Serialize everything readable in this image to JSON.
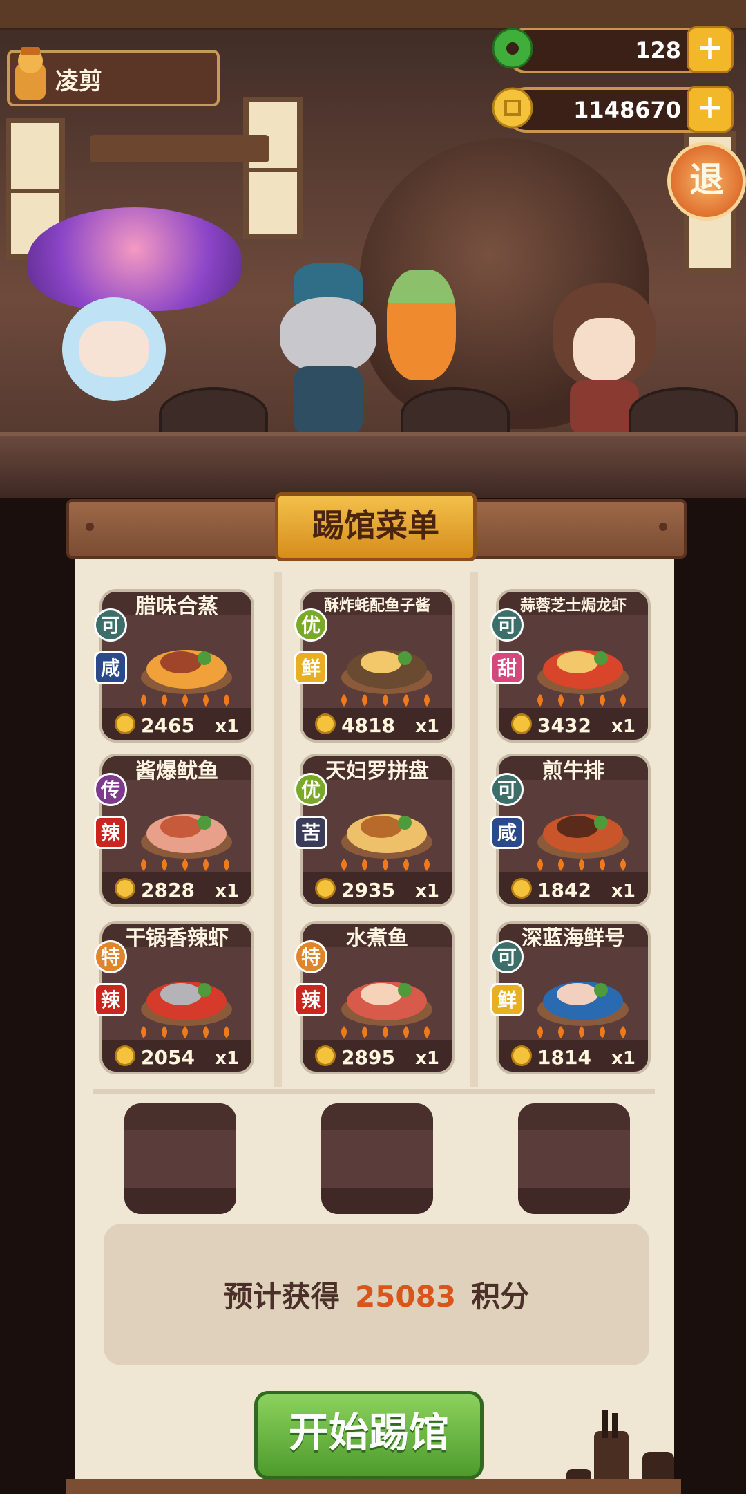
{
  "player": {
    "name": "凌剪"
  },
  "currencies": {
    "jade": {
      "value": "128",
      "icon": "jade-coin-icon",
      "plus": "+"
    },
    "gold": {
      "value": "1148670",
      "icon": "gold-coin-icon",
      "plus": "+"
    }
  },
  "exit_label": "退",
  "menu_title": "踢馆菜单",
  "dishes": [
    {
      "name": "腊味合蒸",
      "grade": "可",
      "flavor": "咸",
      "price": "2465",
      "qty": "x1"
    },
    {
      "name": "酥炸蚝配鱼子酱",
      "grade": "优",
      "flavor": "鲜",
      "price": "4818",
      "qty": "x1"
    },
    {
      "name": "蒜蓉芝士焗龙虾",
      "grade": "可",
      "flavor": "甜",
      "price": "3432",
      "qty": "x1"
    },
    {
      "name": "酱爆鱿鱼",
      "grade": "传",
      "flavor": "辣",
      "price": "2828",
      "qty": "x1"
    },
    {
      "name": "天妇罗拼盘",
      "grade": "优",
      "flavor": "苦",
      "price": "2935",
      "qty": "x1"
    },
    {
      "name": "煎牛排",
      "grade": "可",
      "flavor": "咸",
      "price": "1842",
      "qty": "x1"
    },
    {
      "name": "干锅香辣虾",
      "grade": "特",
      "flavor": "辣",
      "price": "2054",
      "qty": "x1"
    },
    {
      "name": "水煮鱼",
      "grade": "特",
      "flavor": "辣",
      "price": "2895",
      "qty": "x1"
    },
    {
      "name": "深蓝海鲜号",
      "grade": "可",
      "flavor": "鲜",
      "price": "1814",
      "qty": "x1"
    }
  ],
  "estimate": {
    "prefix": "预计获得",
    "points": "25083",
    "suffix": "积分"
  },
  "start_button": "开始踢馆",
  "colors": {
    "grade_可": "#3d6f6a",
    "grade_优": "#7aa92a",
    "grade_传": "#7d3a8e",
    "grade_特": "#e0862a",
    "flavor_咸": "#2a4a8c",
    "flavor_鲜": "#e8b021",
    "flavor_甜": "#d8477a",
    "flavor_辣": "#c8261e",
    "flavor_苦": "#3b3b5a",
    "accent_points": "#d8561c"
  }
}
